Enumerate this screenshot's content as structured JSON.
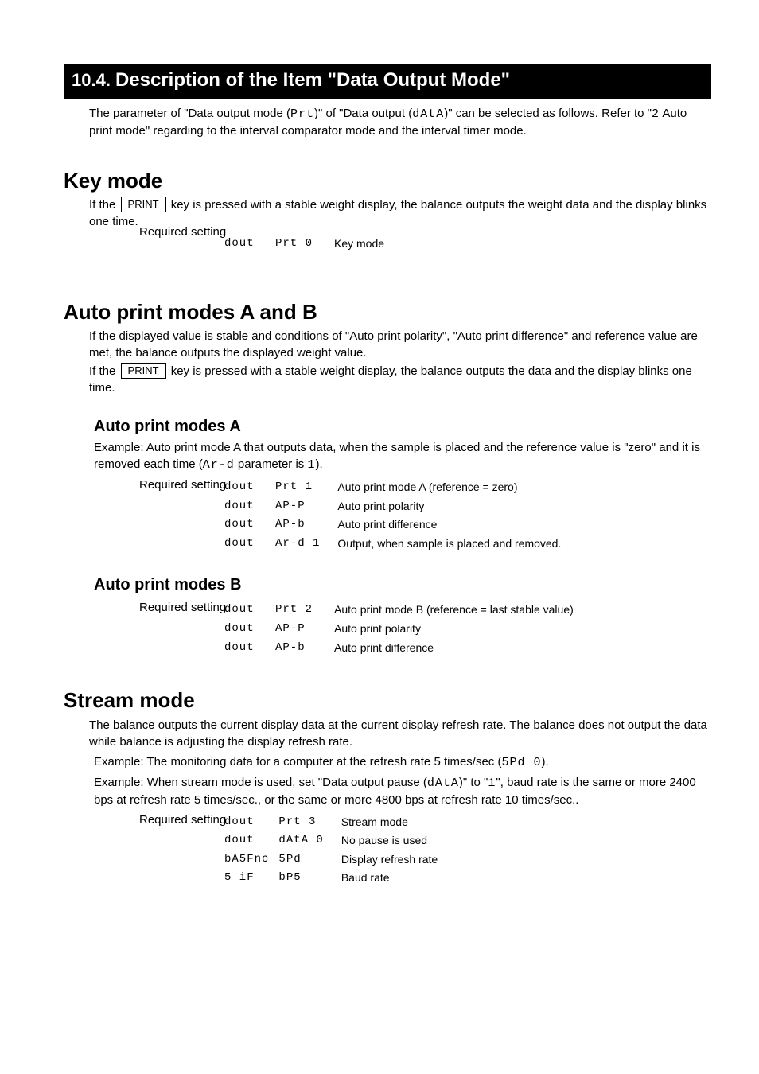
{
  "section": {
    "number": "10.4.",
    "title": "Description of the Item \"Data Output Mode\""
  },
  "intro": {
    "line1_pre": "The parameter of \"Data output mode (",
    "line1_seg": "Prt",
    "line1_post": ")\" of \"Data output (",
    "line2_seg1": "dAtA",
    "line2_mid": ")\" can be selected as follows. Refer to \"",
    "line2_seg2": "2",
    "line2_post": " Auto print mode\" regarding to the interval comparator mode and the interval timer mode."
  },
  "keymode": {
    "heading": "Key mode",
    "line1_pre": "If the ",
    "line1_key": "PRINT",
    "line1_post": " key is pressed with a stable weight display, the balance outputs the weight data and the display blinks one time.",
    "line2_pre": "Required setting   ",
    "line2_k": "dout",
    "line2_v": "Prt 0",
    "line2_desc": "Key mode"
  },
  "autoAB": {
    "heading": "Auto print modes A and B",
    "line1": "If the displayed value is stable and conditions of \"Auto print polarity\", \"Auto print difference\" and reference value are met, the balance outputs the displayed weight value.",
    "line2_pre": "If the ",
    "line2_key": "PRINT",
    "line2_post": " key is pressed with a stable weight display, the balance outputs the data and the display blinks one time."
  },
  "autoA": {
    "heading": "Auto print modes A",
    "line1_pre": "Example:      Auto print mode A that outputs data, when the sample is placed and the reference value is \"zero\" and it is removed each time (",
    "line1_seg": "Ar-d",
    "line1_mid": " parameter is ",
    "line1_seg2": "1",
    "line1_post": ").",
    "settings_label": "Required setting",
    "rows": [
      {
        "k": "dout",
        "v": "Prt 1",
        "d": "Auto print mode A (reference = zero)"
      },
      {
        "k": "dout",
        "v": "AP-P",
        "d": "Auto print polarity"
      },
      {
        "k": "dout",
        "v": "AP-b",
        "d": "Auto print difference"
      },
      {
        "k": "dout",
        "v": "Ar-d 1",
        "d": "Output, when sample is placed and removed."
      }
    ]
  },
  "autoB": {
    "heading": "Auto print modes B",
    "settings_label": "Required setting",
    "rows": [
      {
        "k": "dout",
        "v": "Prt 2",
        "d": "Auto print mode B (reference = last stable value)"
      },
      {
        "k": "dout",
        "v": "AP-P",
        "d": "Auto print polarity"
      },
      {
        "k": "dout",
        "v": "AP-b",
        "d": "Auto print difference"
      }
    ]
  },
  "stream": {
    "heading": "Stream mode",
    "line1": "The balance outputs the current display data at the current display refresh rate. The balance does not output the data while balance is adjusting the display refresh rate.",
    "ex1_pre": "Example:      The monitoring data for a computer at the refresh rate 5 times/sec (",
    "ex1_seg": "5Pd 0",
    "ex1_post": ").",
    "ex2_pre": "Example:      When stream mode is used, set \"Data output pause (",
    "ex2_seg1": "dAtA",
    "ex2_mid": ")\" to \"",
    "ex2_seg2": "1",
    "ex2_post": "\", baud rate is the same or more 2400 bps at refresh rate 5 times/sec., or the same or more 4800 bps at refresh rate 10 times/sec..",
    "settings_label": "Required setting",
    "rows": [
      {
        "k": "dout",
        "v": "Prt 3",
        "d": "Stream mode"
      },
      {
        "k": "dout",
        "v": "dAtA 0",
        "d": "No pause is used"
      },
      {
        "k": "bA5Fnc",
        "v": "5Pd",
        "d": "Display refresh rate"
      },
      {
        "k": "5 iF",
        "v": "bP5",
        "d": "Baud rate"
      }
    ]
  }
}
